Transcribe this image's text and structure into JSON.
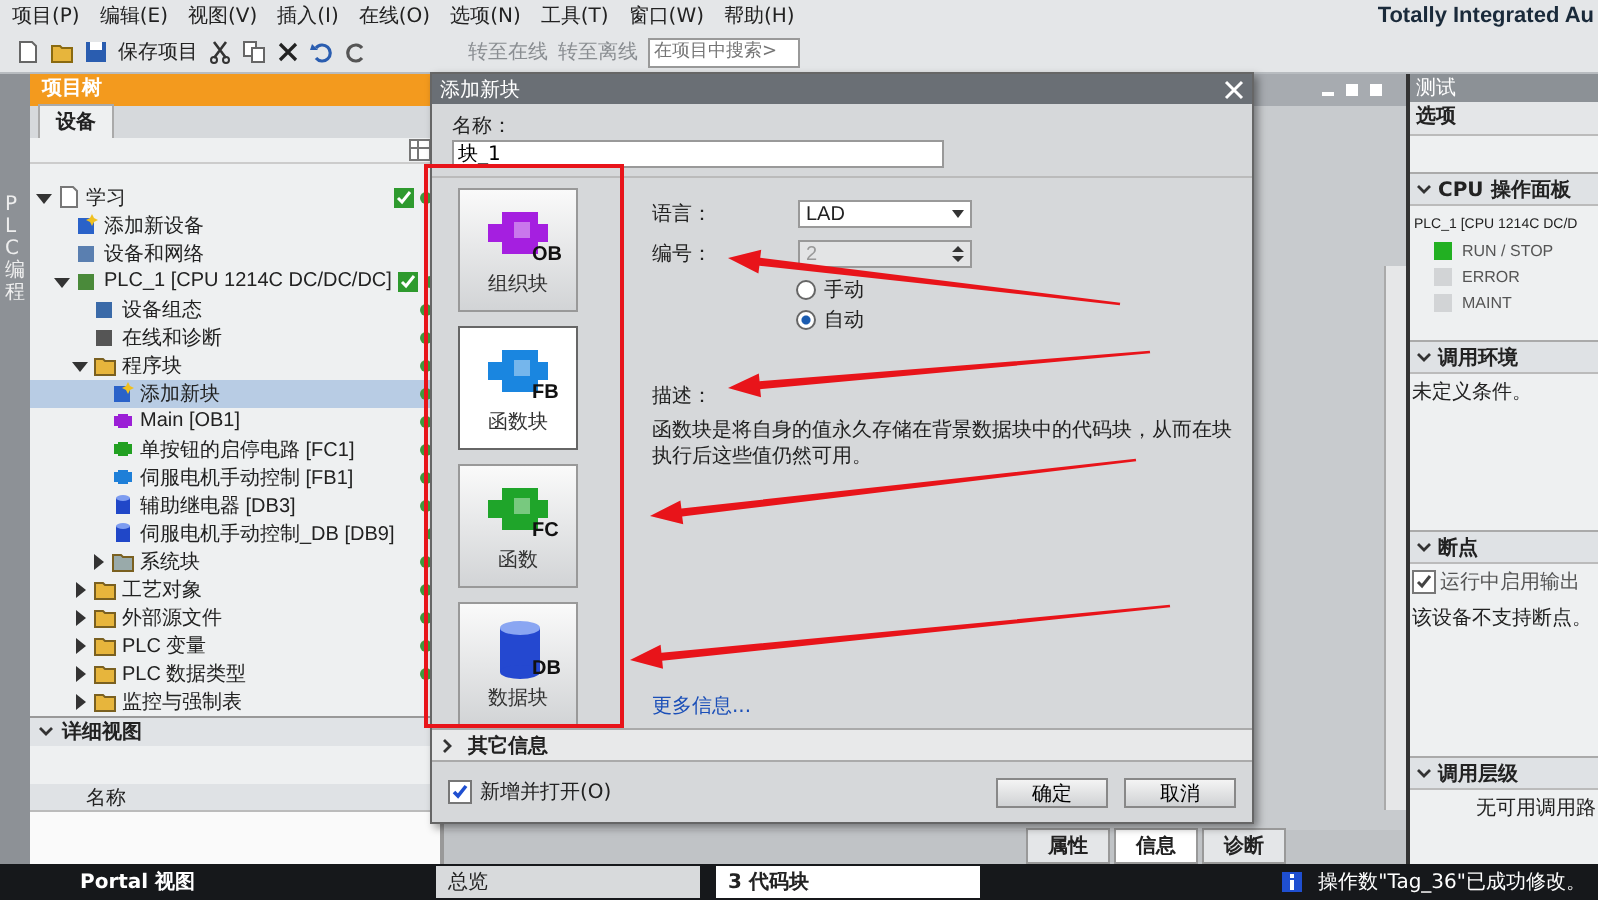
{
  "menu": [
    "项目(P)",
    "编辑(E)",
    "视图(V)",
    "插入(I)",
    "在线(O)",
    "选项(N)",
    "工具(T)",
    "窗口(W)",
    "帮助(H)"
  ],
  "brand": "Totally Integrated Au",
  "toolbar": {
    "save": "保存项目",
    "go_online": "转至在线",
    "go_offline": "转至离线",
    "search_placeholder": "在项目中搜索>"
  },
  "side_strip": "PLC 编程",
  "project_tree": {
    "title": "项目树",
    "tab": "设备",
    "items": [
      {
        "label": "学习",
        "kind": "project",
        "status_check": true,
        "status_dot": true,
        "expanded": true,
        "selected": false,
        "children": [
          {
            "label": "添加新设备",
            "kind": "add",
            "status_check": false,
            "status_dot": false,
            "selected": false
          },
          {
            "label": "设备和网络",
            "kind": "network",
            "status_check": false,
            "status_dot": false,
            "selected": false
          },
          {
            "label": "PLC_1 [CPU 1214C DC/DC/DC]",
            "kind": "plc",
            "status_check": true,
            "status_dot": true,
            "expanded": true,
            "selected": false,
            "children": [
              {
                "label": "设备组态",
                "kind": "config",
                "status_check": false,
                "status_dot": true,
                "selected": false
              },
              {
                "label": "在线和诊断",
                "kind": "diag",
                "status_check": false,
                "status_dot": true,
                "selected": false
              },
              {
                "label": "程序块",
                "kind": "folder",
                "status_check": false,
                "status_dot": true,
                "expanded": true,
                "selected": false,
                "children": [
                  {
                    "label": "添加新块",
                    "kind": "add",
                    "status_check": false,
                    "status_dot": true,
                    "selected": true
                  },
                  {
                    "label": "Main [OB1]",
                    "kind": "ob",
                    "status_check": false,
                    "status_dot": true,
                    "selected": false
                  },
                  {
                    "label": "单按钮的启停电路 [FC1]",
                    "kind": "fc",
                    "status_check": false,
                    "status_dot": true,
                    "selected": false
                  },
                  {
                    "label": "伺服电机手动控制 [FB1]",
                    "kind": "fb",
                    "status_check": false,
                    "status_dot": true,
                    "selected": false
                  },
                  {
                    "label": "辅助继电器 [DB3]",
                    "kind": "db",
                    "status_check": false,
                    "status_dot": true,
                    "selected": false
                  },
                  {
                    "label": "伺服电机手动控制_DB [DB9]",
                    "kind": "db",
                    "status_check": false,
                    "status_dot": true,
                    "selected": false
                  },
                  {
                    "label": "系统块",
                    "kind": "sysfolder",
                    "status_check": false,
                    "status_dot": true,
                    "expanded": false,
                    "selected": false
                  }
                ]
              },
              {
                "label": "工艺对象",
                "kind": "folder",
                "status_check": false,
                "status_dot": true,
                "expanded": false,
                "selected": false
              },
              {
                "label": "外部源文件",
                "kind": "folder",
                "status_check": false,
                "status_dot": true,
                "expanded": false,
                "selected": false
              },
              {
                "label": "PLC 变量",
                "kind": "folder",
                "status_check": false,
                "status_dot": true,
                "expanded": false,
                "selected": false
              },
              {
                "label": "PLC 数据类型",
                "kind": "folder",
                "status_check": false,
                "status_dot": true,
                "expanded": false,
                "selected": false
              },
              {
                "label": "监控与强制表",
                "kind": "folder",
                "status_check": false,
                "status_dot": false,
                "expanded": false,
                "selected": false
              }
            ]
          }
        ]
      }
    ]
  },
  "detail_view": {
    "title": "详细视图",
    "column": "名称"
  },
  "dialog": {
    "title": "添加新块",
    "name_label": "名称：",
    "name_value": "块_1",
    "blocks": [
      {
        "kind": "ob",
        "tag": "OB",
        "label": "组织块",
        "selected": false
      },
      {
        "kind": "fb",
        "tag": "FB",
        "label": "函数块",
        "selected": true
      },
      {
        "kind": "fc",
        "tag": "FC",
        "label": "函数",
        "selected": false
      },
      {
        "kind": "db",
        "tag": "DB",
        "label": "数据块",
        "selected": false
      }
    ],
    "language_label": "语言：",
    "language": "LAD",
    "number_label": "编号：",
    "number": "2",
    "number_disabled": true,
    "radios": [
      {
        "label": "手动",
        "selected": false
      },
      {
        "label": "自动",
        "selected": true
      }
    ],
    "description_label": "描述：",
    "description": "函数块是将自身的值永久存储在背景数据块中的代码块，从而在块执行后这些值仍然可用。",
    "more_info": "更多信息...",
    "other_info": "其它信息",
    "open_checkbox": {
      "label": "新增并打开(O)",
      "checked": true
    },
    "buttons": [
      "确定",
      "取消"
    ]
  },
  "right_panel": {
    "title": "测试",
    "options": "选项",
    "cpu_panel": {
      "title": "CPU 操作面板",
      "device": "PLC_1 [CPU 1214C DC/D",
      "leds": [
        {
          "label": "RUN / STOP",
          "on": true
        },
        {
          "label": "ERROR",
          "on": false
        },
        {
          "label": "MAINT",
          "on": false
        }
      ]
    },
    "call_env": {
      "title": "调用环境",
      "condition": "未定义条件。"
    },
    "breakpoints": {
      "title": "断点",
      "checkbox": {
        "label": "运行中启用输出",
        "checked": true
      },
      "message": "该设备不支持断点。"
    },
    "call_hierarchy": {
      "title": "调用层级",
      "message": "无可用调用路"
    }
  },
  "bottom_tabs": [
    {
      "label": "属性",
      "selected": false
    },
    {
      "label": "信息",
      "selected": true
    },
    {
      "label": "诊断",
      "selected": false
    }
  ],
  "taskbar": {
    "portal": "Portal 视图",
    "tasks": [
      {
        "label": "总览",
        "selected": false
      },
      {
        "label": "3 代码块",
        "selected": true
      }
    ],
    "status": "操作数\"Tag_36\"已成功修改。"
  }
}
